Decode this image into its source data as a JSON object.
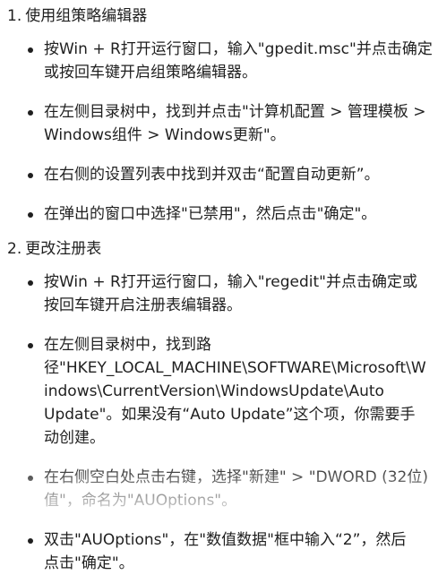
{
  "steps": [
    {
      "number": "1.",
      "title": "使用组策略编辑器",
      "bullets": [
        [
          "按Win + R打开运行窗口，输入\"gpedit.msc\"并点击确定",
          "或按回车键开启组策略编辑器。"
        ],
        [
          "在左侧目录树中，找到并点击\"计算机配置 > 管理模板 >",
          "Windows组件 > Windows更新\"。"
        ],
        [
          "在右侧的设置列表中找到并双击“配置自动更新”。"
        ],
        [
          "在弹出的窗口中选择\"已禁用\"，然后点击\"确定\"。"
        ]
      ]
    },
    {
      "number": "2.",
      "title": "更改注册表",
      "bullets": [
        [
          "按Win + R打开运行窗口，输入\"regedit\"并点击确定或",
          "按回车键开启注册表编辑器。"
        ],
        [
          "在左侧目录树中，找到路",
          "径\"HKEY_LOCAL_MACHINE\\SOFTWARE\\Microsoft\\W",
          "indows\\CurrentVersion\\WindowsUpdate\\Auto",
          "Update\"。如果没有“Auto Update”这个项，你需要手",
          "动创建。"
        ],
        [
          "在右侧空白处点击右键，选择\"新建\" > \"DWORD (32位)",
          "值\"，命名为\"AUOptions\"。"
        ],
        [
          "双击\"AUOptions\"，在\"数值数据\"框中输入“2”，然后",
          "点击\"确定\"。"
        ]
      ]
    }
  ]
}
